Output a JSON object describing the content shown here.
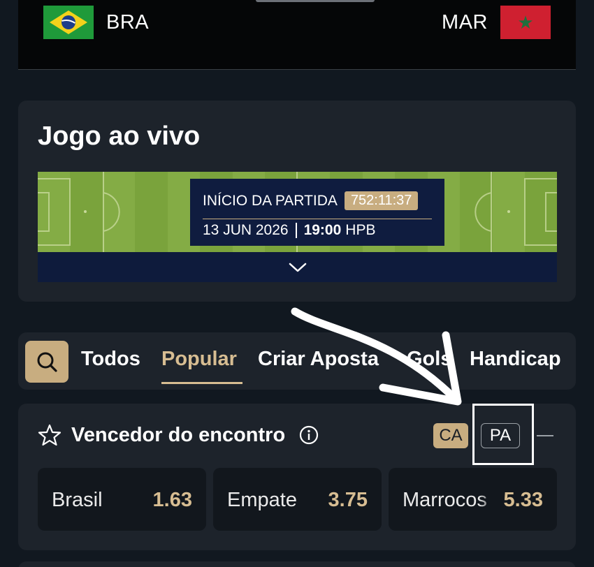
{
  "match": {
    "home": {
      "code": "BRA",
      "flag": "brazil-flag"
    },
    "away": {
      "code": "MAR",
      "flag": "morocco-flag"
    }
  },
  "live": {
    "title": "Jogo ao vivo",
    "kickoff_label": "INÍCIO DA PARTIDA",
    "countdown": "752:11:37",
    "date": "13 JUN 2026",
    "time": "19:00",
    "timezone": "HPB",
    "expand_icon": "chevron-down-icon"
  },
  "tabs": {
    "search_icon": "search-icon",
    "items": [
      {
        "label": "Todos",
        "active": false
      },
      {
        "label": "Popular",
        "active": true
      },
      {
        "label": "Criar Aposta",
        "active": false
      },
      {
        "label": "Gols",
        "active": false
      },
      {
        "label": "Handicap",
        "active": false
      }
    ]
  },
  "market": {
    "title": "Vencedor do encontro",
    "favorite_icon": "star-outline-icon",
    "info_icon": "info-icon",
    "badge_ca": "CA",
    "badge_pa": "PA",
    "odds": [
      {
        "label": "Brasil",
        "value": "1.63"
      },
      {
        "label": "Empate",
        "value": "3.75"
      },
      {
        "label": "Marrocos",
        "value": "5.33"
      }
    ]
  },
  "colors": {
    "background": "#111820",
    "card": "#1d232b",
    "accent": "#c8ad80",
    "accent_text": "#d7bd92",
    "pitch_green": "#7aa33c",
    "navy": "#0f1c3f"
  }
}
